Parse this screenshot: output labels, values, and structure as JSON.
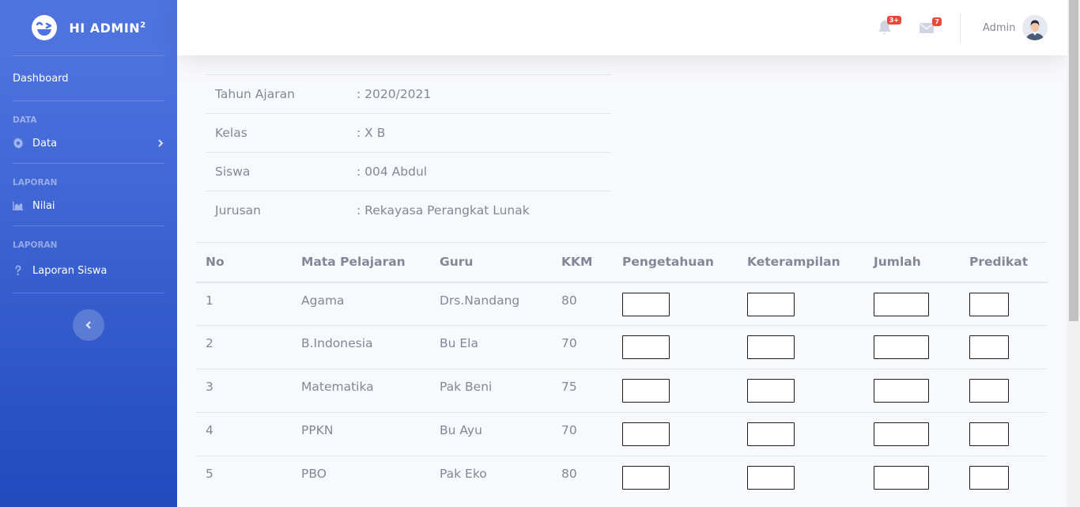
{
  "brand": {
    "title": "HI ADMIN",
    "sup": "2"
  },
  "sidebar": {
    "dashboard": "Dashboard",
    "heading_data": "DATA",
    "data_label": "Data",
    "heading_laporan1": "LAPORAN",
    "nilai_label": "Nilai",
    "heading_laporan2": "LAPORAN",
    "laporan_siswa_label": "Laporan Siswa"
  },
  "topbar": {
    "alerts_badge": "3+",
    "messages_badge": "7",
    "user_name": "Admin"
  },
  "info": [
    {
      "label": "Tahun Ajaran",
      "value": ": 2020/2021"
    },
    {
      "label": "Kelas",
      "value": ": X B"
    },
    {
      "label": "Siswa",
      "value": ": 004 Abdul"
    },
    {
      "label": "Jurusan",
      "value": ": Rekayasa Perangkat Lunak"
    }
  ],
  "table": {
    "headers": [
      "No",
      "Mata Pelajaran",
      "Guru",
      "KKM",
      "Pengetahuan",
      "Keterampilan",
      "Jumlah",
      "Predikat"
    ],
    "rows": [
      {
        "no": "1",
        "mapel": "Agama",
        "guru": "Drs.Nandang",
        "kkm": "80"
      },
      {
        "no": "2",
        "mapel": "B.Indonesia",
        "guru": "Bu Ela",
        "kkm": "70"
      },
      {
        "no": "3",
        "mapel": "Matematika",
        "guru": "Pak Beni",
        "kkm": "75"
      },
      {
        "no": "4",
        "mapel": "PPKN",
        "guru": "Bu Ayu",
        "kkm": "70"
      },
      {
        "no": "5",
        "mapel": "PBO",
        "guru": "Pak Eko",
        "kkm": "80"
      }
    ]
  },
  "colors": {
    "primary": "#4e73df",
    "primary_dark": "#224abe",
    "danger": "#e74a3b",
    "text": "#858796"
  }
}
